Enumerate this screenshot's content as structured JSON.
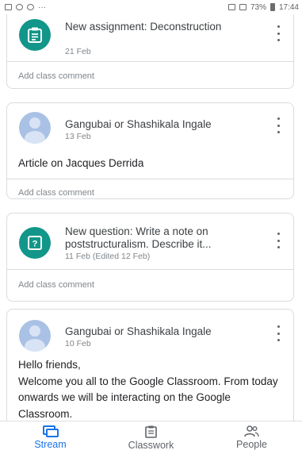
{
  "status_bar": {
    "status_text": "73%",
    "time": "17:44"
  },
  "feed": {
    "items": [
      {
        "type": "assignment",
        "title": "New assignment: Deconstruction",
        "date": "21 Feb",
        "comment_label": "Add class comment"
      },
      {
        "type": "post",
        "author": "Gangubai or Shashikala Ingale",
        "date": "13 Feb",
        "body": "Article on Jacques Derrida",
        "comment_label": "Add class comment"
      },
      {
        "type": "question",
        "title": "New question: Write a note on poststructuralism. Describe it...",
        "date": "11 Feb (Edited 12 Feb)",
        "comment_label": "Add class comment"
      },
      {
        "type": "post",
        "author": "Gangubai or Shashikala Ingale",
        "date": "10 Feb",
        "body": "Hello friends,\nWelcome you all to the Google Classroom. From today onwards we will be interacting on the Google Classroom."
      }
    ]
  },
  "bottom_nav": {
    "items": [
      {
        "label": "Stream",
        "icon": "stream-icon",
        "active": true
      },
      {
        "label": "Classwork",
        "icon": "classwork-icon",
        "active": false
      },
      {
        "label": "People",
        "icon": "people-icon",
        "active": false
      }
    ]
  },
  "colors": {
    "accent": "#1a73e8",
    "assignment_icon": "#12968a",
    "card_border": "#dadce0"
  }
}
